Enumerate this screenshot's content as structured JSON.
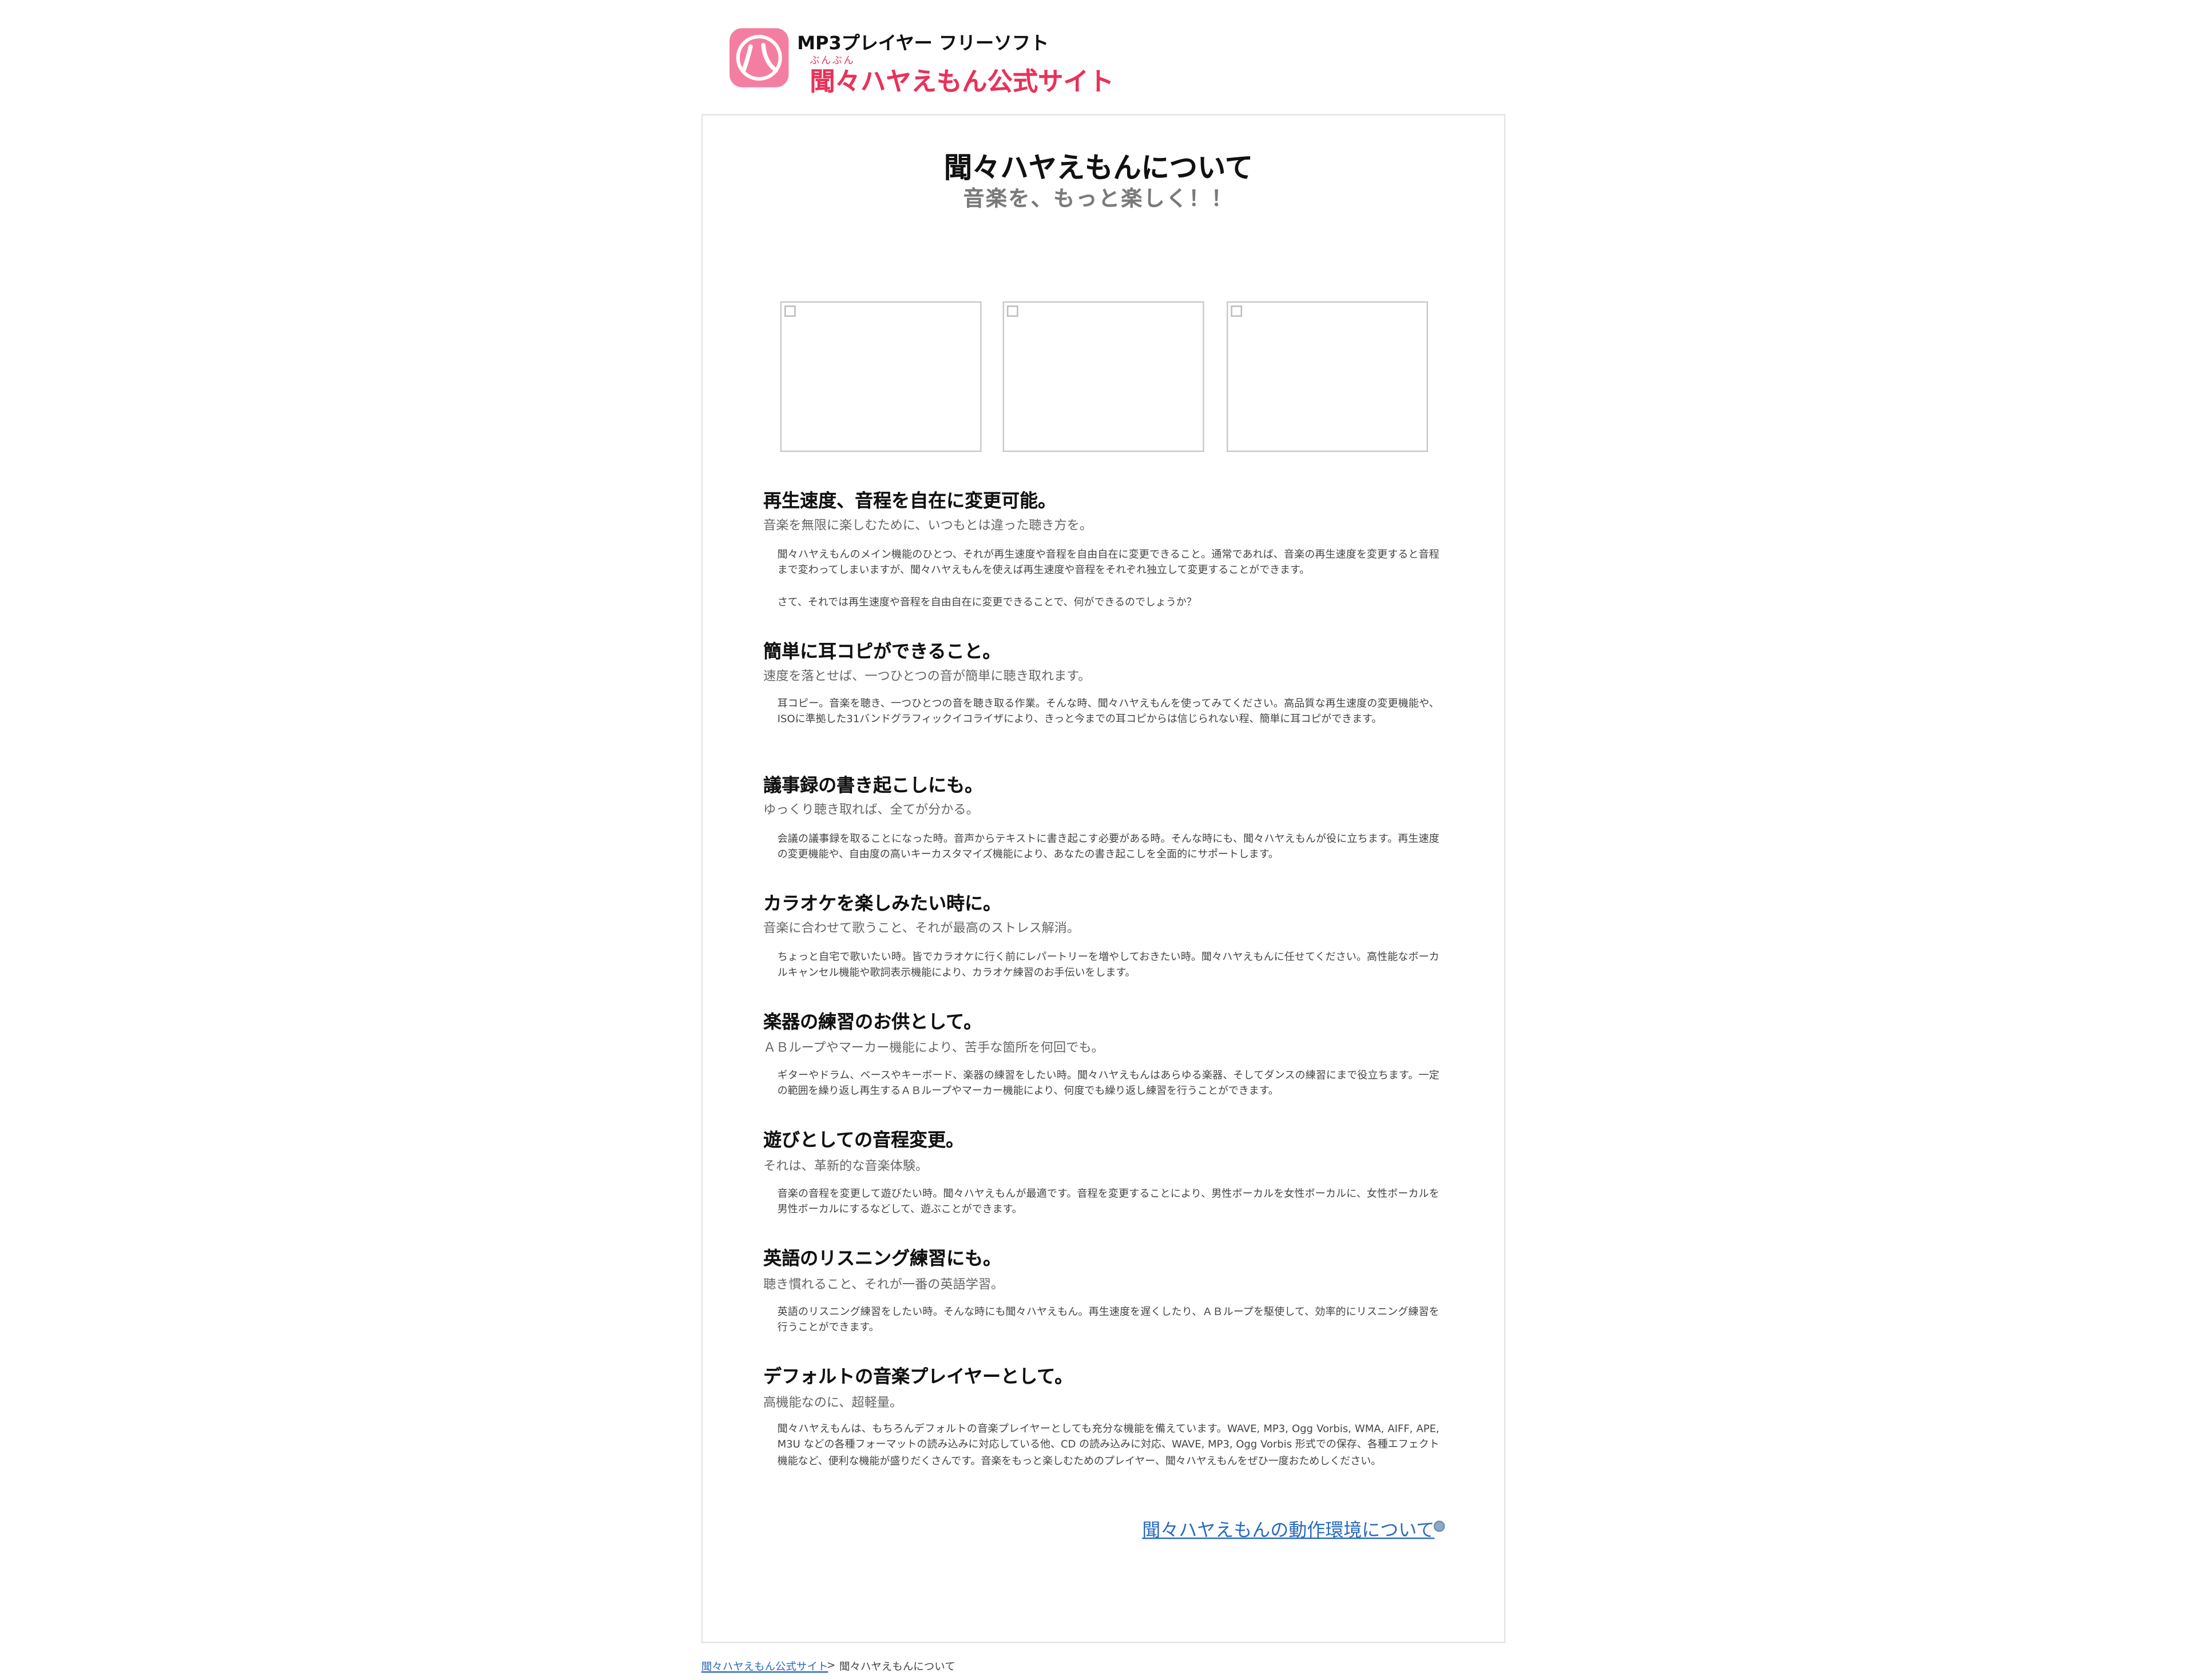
{
  "header": {
    "subtitle": "MP3プレイヤー フリーソフト",
    "ruby": "ぶんぶん",
    "title": "聞々ハヤえもん公式サイト",
    "logo_icon": "hayaemon-logo-icon",
    "accent_color": "#e8325a",
    "logo_color": "#f47ea1"
  },
  "main": {
    "title": "聞々ハヤえもんについて",
    "subtitle": "音楽を、もっと楽しく！！",
    "screenshots": [
      "broken-image-icon",
      "broken-image-icon",
      "broken-image-icon"
    ],
    "sections": [
      {
        "heading": "再生速度、音程を自在に変更可能。",
        "sub": "音楽を無限に楽しむために、いつもとは違った聴き方を。",
        "paragraphs": [
          "聞々ハヤえもんのメイン機能のひとつ、それが再生速度や音程を自由自在に変更できること。通常であれば、音楽の再生速度を変更すると音程まで変わってしまいますが、聞々ハヤえもんを使えば再生速度や音程をそれぞれ独立して変更することができます。",
          "さて、それでは再生速度や音程を自由自在に変更できることで、何ができるのでしょうか？"
        ]
      },
      {
        "heading": "簡単に耳コピができること。",
        "sub": "速度を落とせば、一つひとつの音が簡単に聴き取れます。",
        "paragraphs": [
          "耳コピー。音楽を聴き、一つひとつの音を聴き取る作業。そんな時、聞々ハヤえもんを使ってみてください。高品質な再生速度の変更機能や、ISOに準拠した31バンドグラフィックイコライザにより、きっと今までの耳コピからは信じられない程、簡単に耳コピができます。"
        ]
      },
      {
        "heading": "議事録の書き起こしにも。",
        "sub": "ゆっくり聴き取れば、全てが分かる。",
        "paragraphs": [
          "会議の議事録を取ることになった時。音声からテキストに書き起こす必要がある時。そんな時にも、聞々ハヤえもんが役に立ちます。再生速度の変更機能や、自由度の高いキーカスタマイズ機能により、あなたの書き起こしを全面的にサポートします。"
        ]
      },
      {
        "heading": "カラオケを楽しみたい時に。",
        "sub": "音楽に合わせて歌うこと、それが最高のストレス解消。",
        "paragraphs": [
          "ちょっと自宅で歌いたい時。皆でカラオケに行く前にレパートリーを増やしておきたい時。聞々ハヤえもんに任せてください。高性能なボーカルキャンセル機能や歌詞表示機能により、カラオケ練習のお手伝いをします。"
        ]
      },
      {
        "heading": "楽器の練習のお供として。",
        "sub": "ＡＢループやマーカー機能により、苦手な箇所を何回でも。",
        "paragraphs": [
          "ギターやドラム、ベースやキーボード、楽器の練習をしたい時。聞々ハヤえもんはあらゆる楽器、そしてダンスの練習にまで役立ちます。一定の範囲を繰り返し再生するＡＢループやマーカー機能により、何度でも繰り返し練習を行うことができます。"
        ]
      },
      {
        "heading": "遊びとしての音程変更。",
        "sub": "それは、革新的な音楽体験。",
        "paragraphs": [
          "音楽の音程を変更して遊びたい時。聞々ハヤえもんが最適です。音程を変更することにより、男性ボーカルを女性ボーカルに、女性ボーカルを男性ボーカルにするなどして、遊ぶことができます。"
        ]
      },
      {
        "heading": "英語のリスニング練習にも。",
        "sub": "聴き慣れること、それが一番の英語学習。",
        "paragraphs": [
          "英語のリスニング練習をしたい時。そんな時にも聞々ハヤえもん。再生速度を遅くしたり、ＡＢループを駆使して、効率的にリスニング練習を行うことができます。"
        ]
      },
      {
        "heading": "デフォルトの音楽プレイヤーとして。",
        "sub": "高機能なのに、超軽量。",
        "paragraphs": [
          "聞々ハヤえもんは、もちろんデフォルトの音楽プレイヤーとしても充分な機能を備えています。WAVE, MP3, Ogg Vorbis, WMA, AIFF, APE, M3U などの各種フォーマットの読み込みに対応している他、CD の読み込みに対応、WAVE, MP3, Ogg Vorbis 形式での保存、各種エフェクト機能など、便利な機能が盛りだくさんです。音楽をもっと楽しむためのプレイヤー、聞々ハヤえもんをぜひ一度おためしください。"
        ]
      }
    ],
    "more_link": "聞々ハヤえもんの動作環境について",
    "more_icon": "circle-arrow-icon"
  },
  "breadcrumb": {
    "home": "聞々ハヤえもん公式サイト",
    "separator": ">",
    "current": "聞々ハヤえもんについて"
  }
}
